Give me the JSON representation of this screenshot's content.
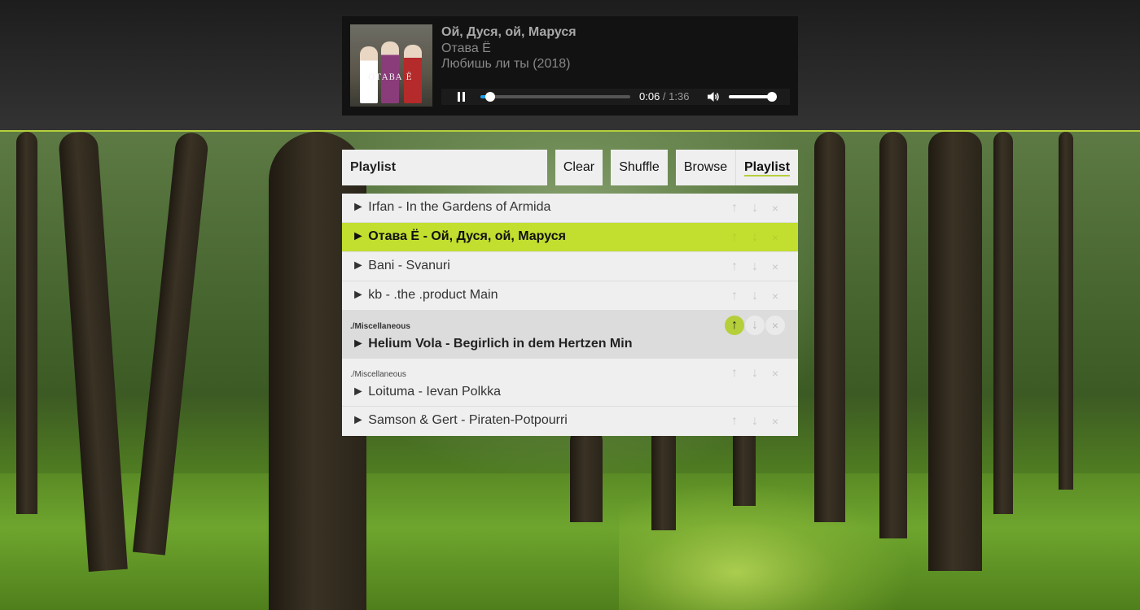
{
  "player": {
    "title": "Ой, Дуся, ой, Маруся",
    "artist": "Отава Ё",
    "album": "Любишь ли ты (2018)",
    "cover_text": "ОТАВА Ё",
    "time_current": "0:06",
    "time_separator": " / ",
    "time_total": "1:36",
    "progress_fraction": 0.0625,
    "volume_fraction": 0.95
  },
  "toolbar": {
    "playlist_name": "Playlist",
    "clear_label": "Clear",
    "shuffle_label": "Shuffle",
    "browse_label": "Browse",
    "playlist_label": "Playlist"
  },
  "playlist": {
    "items": [
      {
        "label": "► Irfan - In the Gardens of Armida",
        "folder": ""
      },
      {
        "label": "► Отава Ё - Ой, Дуся, ой, Маруся",
        "folder": ""
      },
      {
        "label": "► Bani - Svanuri",
        "folder": ""
      },
      {
        "label": "► kb - .the .product Main",
        "folder": ""
      },
      {
        "label": "► Helium Vola - Begirlich in dem Hertzen Min",
        "folder": "./Miscellaneous"
      },
      {
        "label": "► Loituma - Ievan Polkka",
        "folder": "./Miscellaneous"
      },
      {
        "label": "► Samson & Gert - Piraten-Potpourri",
        "folder": ""
      }
    ],
    "move_up_glyph": "↑",
    "move_down_glyph": "↓",
    "remove_glyph": "×"
  },
  "colors": {
    "accent": "#b5cf3a",
    "active_row": "#c2de2f",
    "progress": "#1e9ce8"
  },
  "icons": [
    "pause-icon",
    "volume-icon",
    "arrow-up-icon",
    "arrow-down-icon",
    "close-icon"
  ]
}
